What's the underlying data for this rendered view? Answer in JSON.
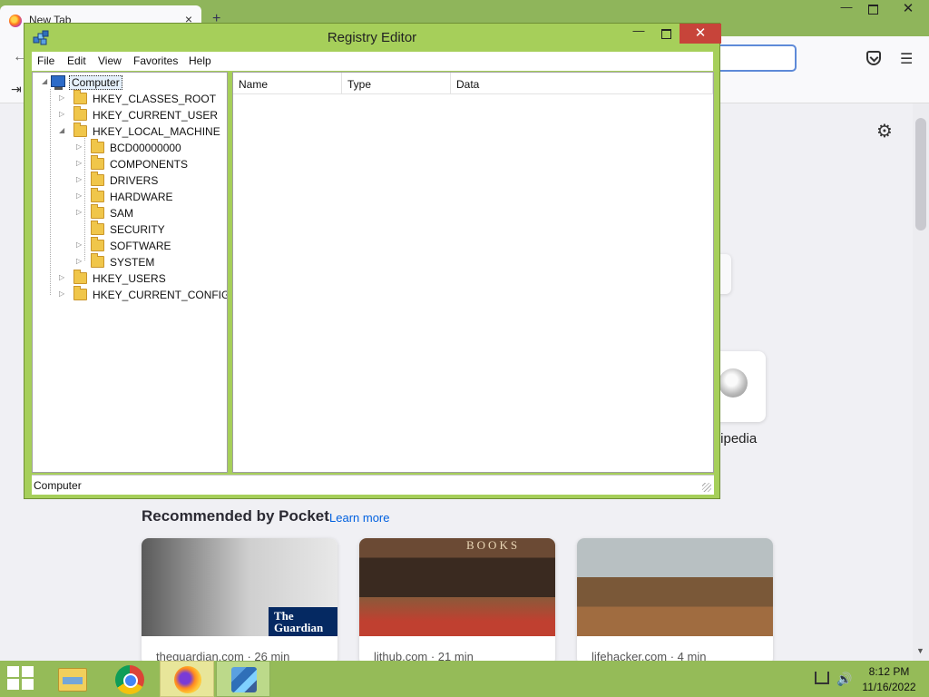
{
  "browser": {
    "tab_title": "New Tab",
    "tab_close": "×",
    "new_tab": "+",
    "back_icon": "←",
    "menu_icon": "☰",
    "import_icon": "⇥",
    "gear_icon": "⚙",
    "wiki_label": "tipedia",
    "pocket_heading": "Recommended by Pocket",
    "learn_more": "Learn more",
    "cards": [
      {
        "source": "theguardian.com · 26 min",
        "badge_line1": "The",
        "badge_line2": "Guardian"
      },
      {
        "source": "lithub.com · 21 min",
        "sign": "BOOKS"
      },
      {
        "source": "lifehacker.com · 4 min"
      }
    ],
    "window_controls": {
      "minimize": "—",
      "restore": "",
      "close": "✕"
    }
  },
  "regedit": {
    "title": "Registry Editor",
    "controls": {
      "minimize": "—",
      "close": "✕"
    },
    "menu": [
      "File",
      "Edit",
      "View",
      "Favorites",
      "Help"
    ],
    "tree": {
      "root": "Computer",
      "hives": [
        {
          "label": "HKEY_CLASSES_ROOT",
          "expander": "▷"
        },
        {
          "label": "HKEY_CURRENT_USER",
          "expander": "▷"
        },
        {
          "label": "HKEY_LOCAL_MACHINE",
          "expander": "◢"
        },
        {
          "label": "HKEY_USERS",
          "expander": "▷"
        },
        {
          "label": "HKEY_CURRENT_CONFIG",
          "expander": "▷"
        }
      ],
      "hklm_children": [
        {
          "label": "BCD00000000",
          "expander": "▷"
        },
        {
          "label": "COMPONENTS",
          "expander": "▷"
        },
        {
          "label": "DRIVERS",
          "expander": "▷"
        },
        {
          "label": "HARDWARE",
          "expander": "▷"
        },
        {
          "label": "SAM",
          "expander": "▷"
        },
        {
          "label": "SECURITY",
          "expander": ""
        },
        {
          "label": "SOFTWARE",
          "expander": "▷"
        },
        {
          "label": "SYSTEM",
          "expander": "▷"
        }
      ]
    },
    "columns": [
      "Name",
      "Type",
      "Data"
    ],
    "status": "Computer"
  },
  "taskbar": {
    "volume_icon": "🔊",
    "time": "8:12 PM",
    "date": "11/16/2022"
  },
  "colors": {
    "accent": "#a6cf5a",
    "close_red": "#c7443a",
    "link": "#0060df"
  }
}
